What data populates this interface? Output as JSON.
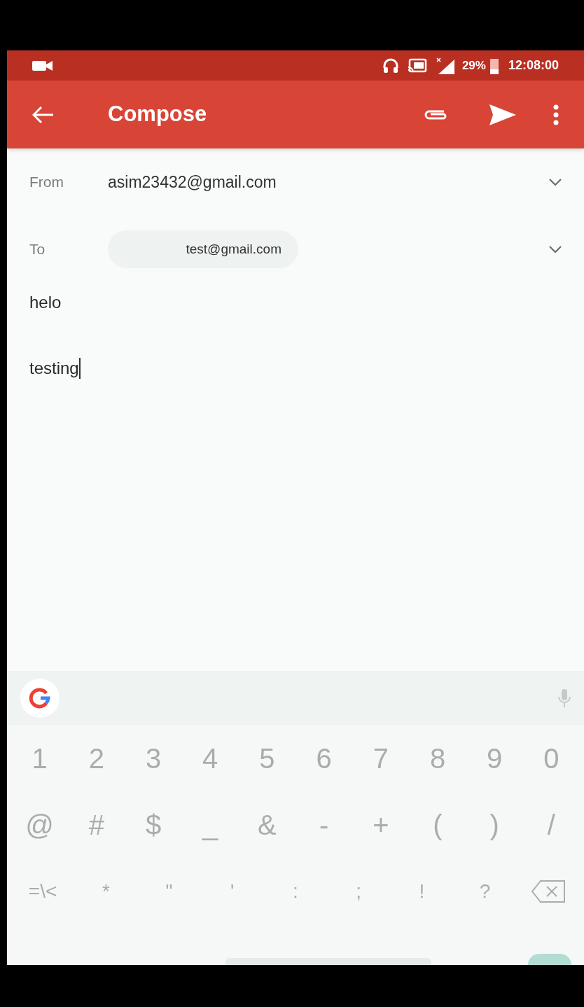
{
  "status_bar": {
    "battery": "29%",
    "time": "12:08:00"
  },
  "app_bar": {
    "title": "Compose"
  },
  "fields": [
    {
      "label": "From",
      "value": "asim23432@gmail.com",
      "kind": "text"
    },
    {
      "label": "To",
      "value": "test@gmail.com",
      "kind": "chip"
    }
  ],
  "subject": "helo",
  "body": "testing",
  "keyboard": {
    "rows": [
      [
        "1",
        "2",
        "3",
        "4",
        "5",
        "6",
        "7",
        "8",
        "9",
        "0"
      ],
      [
        "@",
        "#",
        "$",
        "_",
        "&",
        "-",
        "+",
        "(",
        ")",
        "/"
      ],
      [
        "=\\<",
        "*",
        "\"",
        "'",
        ":",
        ";",
        "!",
        "?"
      ]
    ]
  }
}
